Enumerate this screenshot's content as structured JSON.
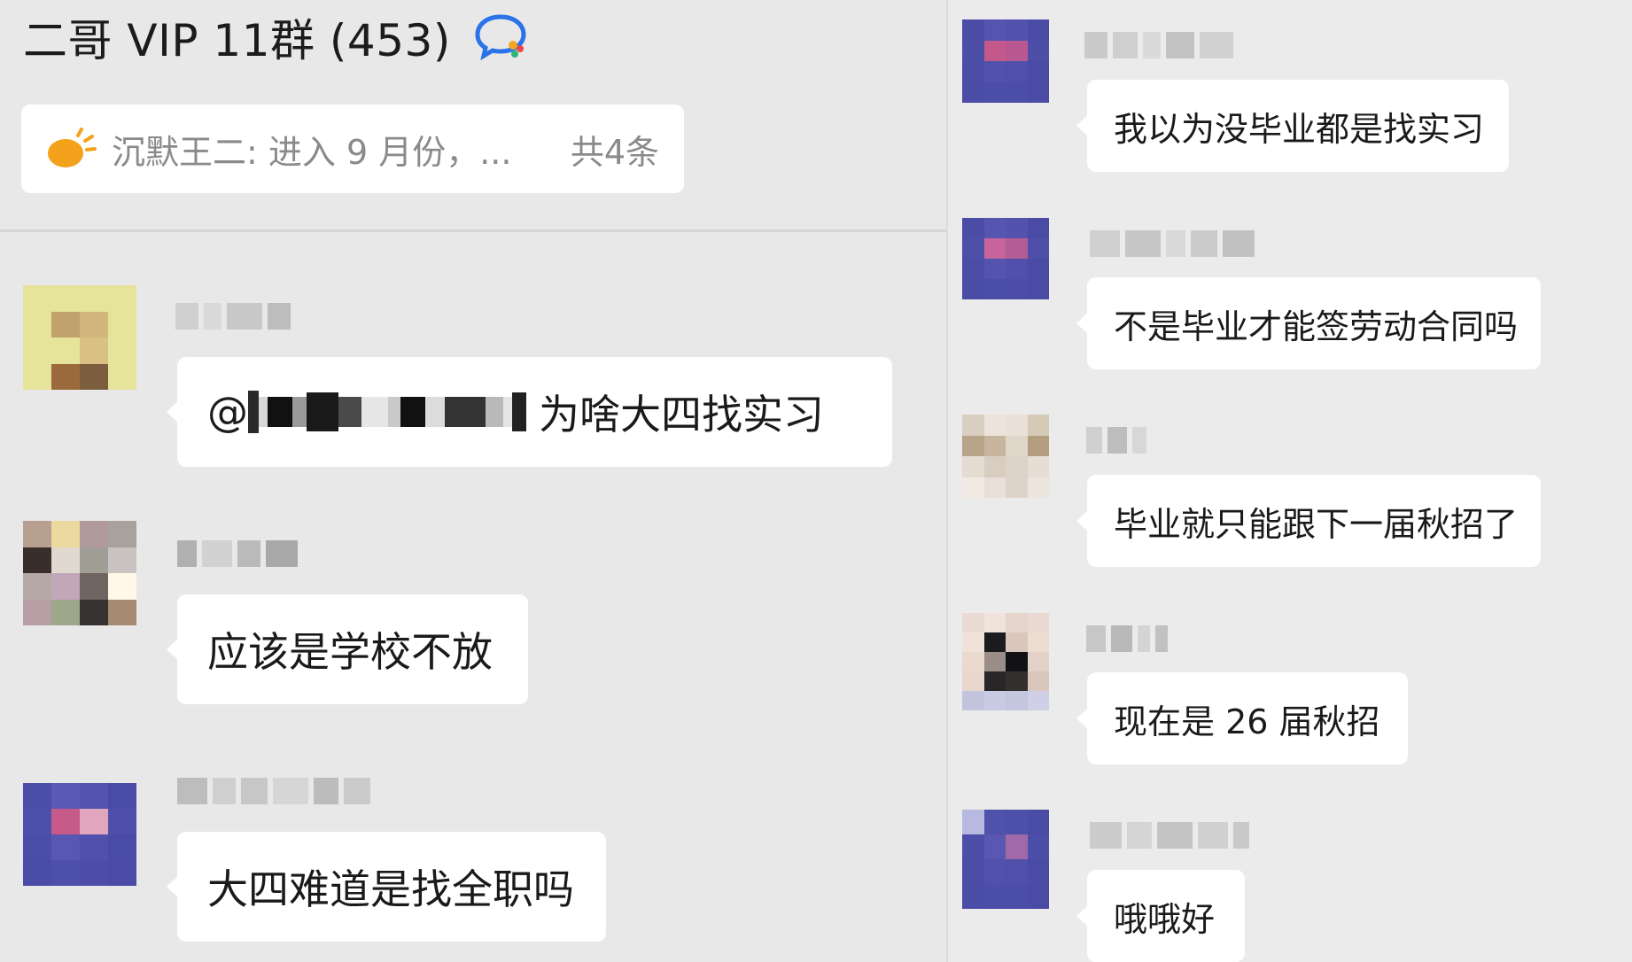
{
  "header": {
    "title": "二哥 VIP 11群 (453)",
    "icon": "chat-bubbles-icon"
  },
  "pinned": {
    "text": "沉默王二: 进入 9 月份，...",
    "count": "共4条",
    "icon": "sun-icon"
  },
  "left_messages": [
    {
      "text": "为啥大四找实习",
      "mention_prefix": "@"
    },
    {
      "text": "应该是学校不放"
    },
    {
      "text": "大四难道是找全职吗"
    }
  ],
  "right_messages": [
    {
      "text": "我以为没毕业都是找实习"
    },
    {
      "text": "不是毕业才能签劳动合同吗"
    },
    {
      "text": "毕业就只能跟下一届秋招了"
    },
    {
      "text": "现在是 26 届秋招"
    },
    {
      "text": "哦哦好"
    }
  ],
  "colors": {
    "background": "#e8e8e8",
    "bubble": "#ffffff",
    "muted_text": "#8a8a8a",
    "title_icon_blue": "#2b73e8",
    "title_icon_orange": "#f5a623",
    "notice_orange": "#f4a21b"
  }
}
